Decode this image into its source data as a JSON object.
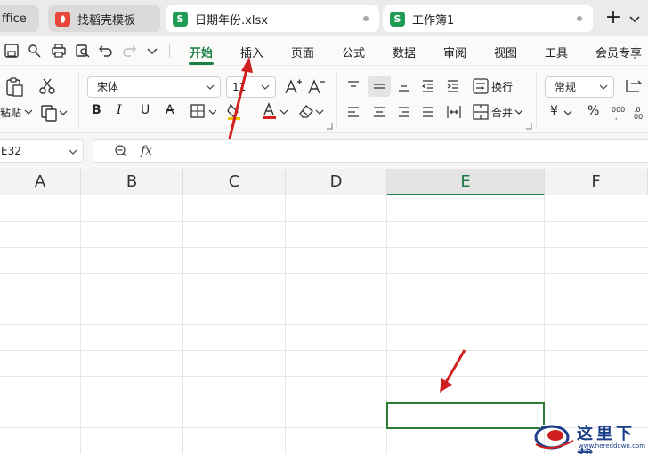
{
  "tabs": [
    {
      "label": "ffice",
      "icon": ""
    },
    {
      "label": "找稻壳模板",
      "icon": "docer-icon"
    },
    {
      "label": "日期年份.xlsx",
      "icon": "S"
    },
    {
      "label": "工作簿1",
      "icon": "S"
    }
  ],
  "menu": [
    "开始",
    "插入",
    "页面",
    "公式",
    "数据",
    "审阅",
    "视图",
    "工具",
    "会员专享"
  ],
  "ribbon": {
    "paste_label": "粘贴",
    "font_name": "宋体",
    "font_size": "11",
    "wrap_label": "换行",
    "merge_label": "合并",
    "number_format": "常规",
    "currency_symbol": "¥",
    "percent_symbol": "%"
  },
  "formula": {
    "name_box": "E32",
    "fx": "fx"
  },
  "columns": [
    "A",
    "B",
    "C",
    "D",
    "E",
    "F"
  ],
  "selected_column": "E",
  "watermark": {
    "title": "这里下载",
    "url": "www.hereddown.com"
  },
  "colors": {
    "accent": "#1a8046",
    "selection": "#2e7d32",
    "arrow": "#d01f1f"
  }
}
